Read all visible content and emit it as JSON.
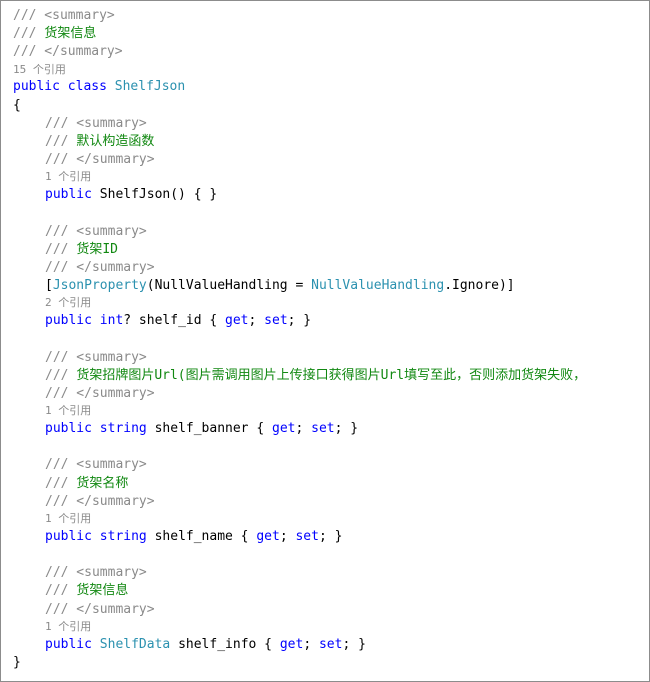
{
  "lines": [
    {
      "indent": false,
      "tokens": [
        {
          "t": "/// <summary>",
          "c": "gray"
        }
      ]
    },
    {
      "indent": false,
      "tokens": [
        {
          "t": "/// ",
          "c": "gray"
        },
        {
          "t": "货架信息",
          "c": "green"
        }
      ]
    },
    {
      "indent": false,
      "tokens": [
        {
          "t": "/// </summary>",
          "c": "gray"
        }
      ]
    },
    {
      "indent": false,
      "lens": true,
      "tokens": [
        {
          "t": "15 个引用",
          "c": "gray"
        }
      ]
    },
    {
      "indent": false,
      "tokens": [
        {
          "t": "public",
          "c": "kw"
        },
        {
          "t": " ",
          "c": "plain"
        },
        {
          "t": "class",
          "c": "kw"
        },
        {
          "t": " ",
          "c": "plain"
        },
        {
          "t": "ShelfJson",
          "c": "type"
        }
      ]
    },
    {
      "indent": false,
      "tokens": [
        {
          "t": "{",
          "c": "plain"
        }
      ]
    },
    {
      "indent": true,
      "tokens": [
        {
          "t": "/// <summary>",
          "c": "gray"
        }
      ]
    },
    {
      "indent": true,
      "tokens": [
        {
          "t": "/// ",
          "c": "gray"
        },
        {
          "t": "默认构造函数",
          "c": "green"
        }
      ]
    },
    {
      "indent": true,
      "tokens": [
        {
          "t": "/// </summary>",
          "c": "gray"
        }
      ]
    },
    {
      "indent": true,
      "lens": true,
      "tokens": [
        {
          "t": "1 个引用",
          "c": "gray"
        }
      ]
    },
    {
      "indent": true,
      "tokens": [
        {
          "t": "public",
          "c": "kw"
        },
        {
          "t": " ShelfJson() { }",
          "c": "plain"
        }
      ]
    },
    {
      "indent": true,
      "tokens": []
    },
    {
      "indent": true,
      "tokens": [
        {
          "t": "/// <summary>",
          "c": "gray"
        }
      ]
    },
    {
      "indent": true,
      "tokens": [
        {
          "t": "/// ",
          "c": "gray"
        },
        {
          "t": "货架ID",
          "c": "green"
        }
      ]
    },
    {
      "indent": true,
      "tokens": [
        {
          "t": "/// </summary>",
          "c": "gray"
        }
      ]
    },
    {
      "indent": true,
      "tokens": [
        {
          "t": "[",
          "c": "plain"
        },
        {
          "t": "JsonProperty",
          "c": "type"
        },
        {
          "t": "(NullValueHandling = ",
          "c": "plain"
        },
        {
          "t": "NullValueHandling",
          "c": "type"
        },
        {
          "t": ".Ignore)]",
          "c": "plain"
        }
      ]
    },
    {
      "indent": true,
      "lens": true,
      "tokens": [
        {
          "t": "2 个引用",
          "c": "gray"
        }
      ]
    },
    {
      "indent": true,
      "tokens": [
        {
          "t": "public",
          "c": "kw"
        },
        {
          "t": " ",
          "c": "plain"
        },
        {
          "t": "int",
          "c": "kw"
        },
        {
          "t": "? shelf_id { ",
          "c": "plain"
        },
        {
          "t": "get",
          "c": "kw"
        },
        {
          "t": "; ",
          "c": "plain"
        },
        {
          "t": "set",
          "c": "kw"
        },
        {
          "t": "; }",
          "c": "plain"
        }
      ]
    },
    {
      "indent": true,
      "tokens": []
    },
    {
      "indent": true,
      "tokens": [
        {
          "t": "/// <summary>",
          "c": "gray"
        }
      ]
    },
    {
      "indent": true,
      "tokens": [
        {
          "t": "/// ",
          "c": "gray"
        },
        {
          "t": "货架招牌图片Url(图片需调用图片上传接口获得图片Url填写至此，否则添加货架失败，",
          "c": "green"
        }
      ]
    },
    {
      "indent": true,
      "tokens": [
        {
          "t": "/// </summary>",
          "c": "gray"
        }
      ]
    },
    {
      "indent": true,
      "lens": true,
      "tokens": [
        {
          "t": "1 个引用",
          "c": "gray"
        }
      ]
    },
    {
      "indent": true,
      "tokens": [
        {
          "t": "public",
          "c": "kw"
        },
        {
          "t": " ",
          "c": "plain"
        },
        {
          "t": "string",
          "c": "kw"
        },
        {
          "t": " shelf_banner { ",
          "c": "plain"
        },
        {
          "t": "get",
          "c": "kw"
        },
        {
          "t": "; ",
          "c": "plain"
        },
        {
          "t": "set",
          "c": "kw"
        },
        {
          "t": "; }",
          "c": "plain"
        }
      ]
    },
    {
      "indent": true,
      "tokens": []
    },
    {
      "indent": true,
      "tokens": [
        {
          "t": "/// <summary>",
          "c": "gray"
        }
      ]
    },
    {
      "indent": true,
      "tokens": [
        {
          "t": "/// ",
          "c": "gray"
        },
        {
          "t": "货架名称",
          "c": "green"
        }
      ]
    },
    {
      "indent": true,
      "tokens": [
        {
          "t": "/// </summary>",
          "c": "gray"
        }
      ]
    },
    {
      "indent": true,
      "lens": true,
      "tokens": [
        {
          "t": "1 个引用",
          "c": "gray"
        }
      ]
    },
    {
      "indent": true,
      "tokens": [
        {
          "t": "public",
          "c": "kw"
        },
        {
          "t": " ",
          "c": "plain"
        },
        {
          "t": "string",
          "c": "kw"
        },
        {
          "t": " shelf_name { ",
          "c": "plain"
        },
        {
          "t": "get",
          "c": "kw"
        },
        {
          "t": "; ",
          "c": "plain"
        },
        {
          "t": "set",
          "c": "kw"
        },
        {
          "t": "; }",
          "c": "plain"
        }
      ]
    },
    {
      "indent": true,
      "tokens": []
    },
    {
      "indent": true,
      "tokens": [
        {
          "t": "/// <summary>",
          "c": "gray"
        }
      ]
    },
    {
      "indent": true,
      "tokens": [
        {
          "t": "/// ",
          "c": "gray"
        },
        {
          "t": "货架信息",
          "c": "green"
        }
      ]
    },
    {
      "indent": true,
      "tokens": [
        {
          "t": "/// </summary>",
          "c": "gray"
        }
      ]
    },
    {
      "indent": true,
      "lens": true,
      "tokens": [
        {
          "t": "1 个引用",
          "c": "gray"
        }
      ]
    },
    {
      "indent": true,
      "tokens": [
        {
          "t": "public",
          "c": "kw"
        },
        {
          "t": " ",
          "c": "plain"
        },
        {
          "t": "ShelfData",
          "c": "type"
        },
        {
          "t": " shelf_info { ",
          "c": "plain"
        },
        {
          "t": "get",
          "c": "kw"
        },
        {
          "t": "; ",
          "c": "plain"
        },
        {
          "t": "set",
          "c": "kw"
        },
        {
          "t": "; }",
          "c": "plain"
        }
      ]
    },
    {
      "indent": false,
      "tokens": [
        {
          "t": "}",
          "c": "plain"
        }
      ]
    }
  ]
}
